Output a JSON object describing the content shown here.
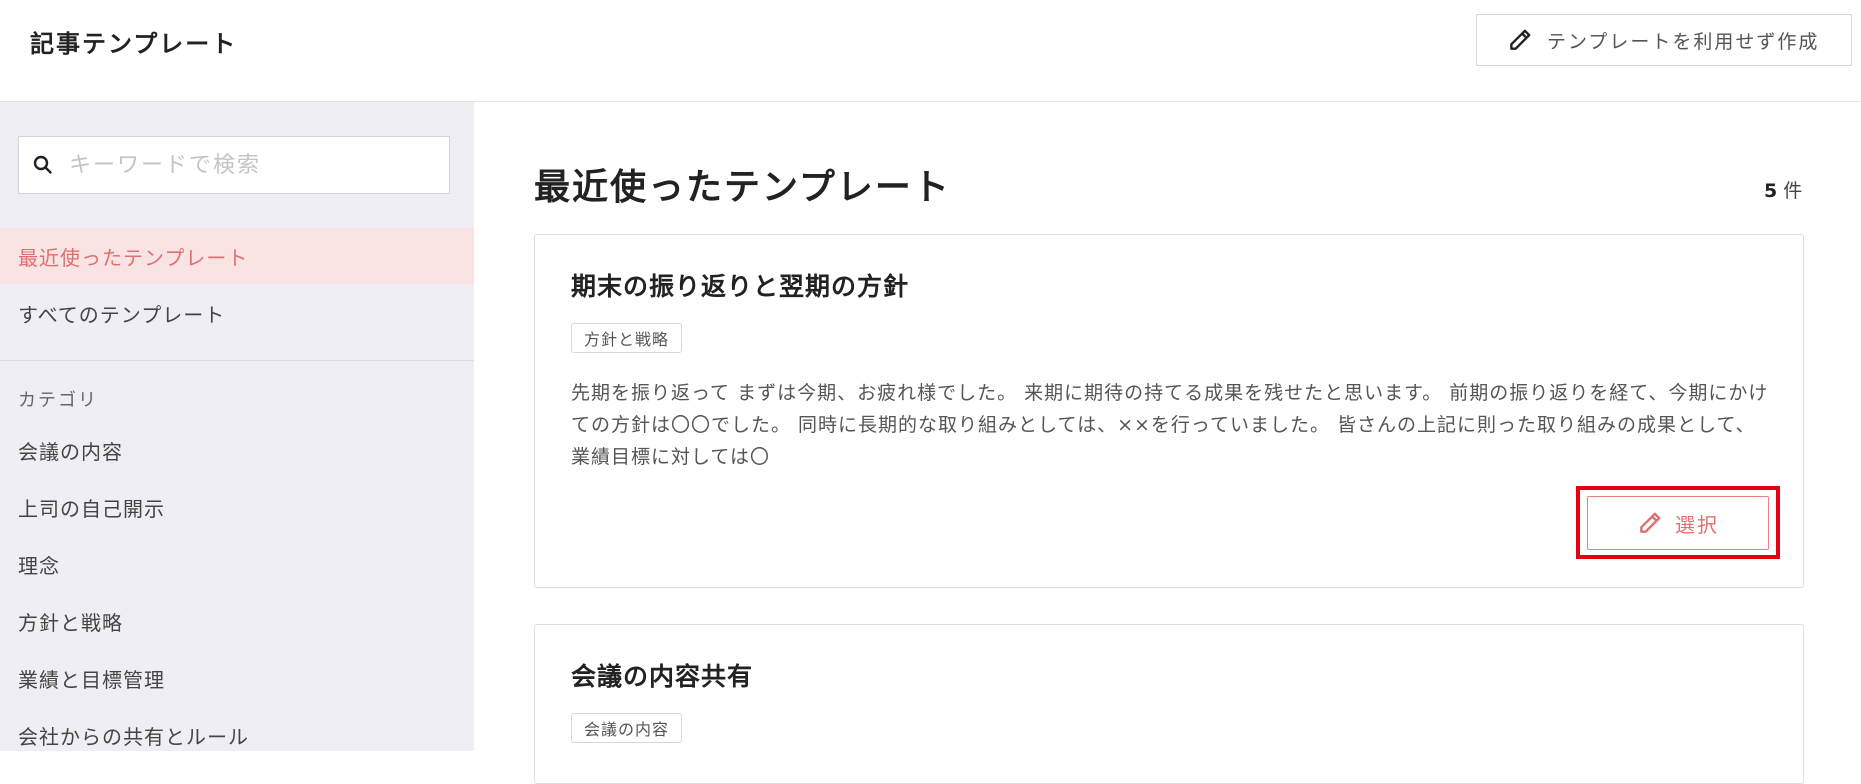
{
  "header": {
    "title": "記事テンプレート",
    "create_without_template_label": "テンプレートを利用せず作成",
    "create_icon": "pencil-icon"
  },
  "sidebar": {
    "search": {
      "placeholder": "キーワードで検索",
      "value": "",
      "icon": "search-icon"
    },
    "nav": [
      {
        "label": "最近使ったテンプレート",
        "active": true
      },
      {
        "label": "すべてのテンプレート",
        "active": false
      }
    ],
    "category_heading": "カテゴリ",
    "categories": [
      {
        "label": "会議の内容"
      },
      {
        "label": "上司の自己開示"
      },
      {
        "label": "理念"
      },
      {
        "label": "方針と戦略"
      },
      {
        "label": "業績と目標管理"
      },
      {
        "label": "会社からの共有とルール"
      }
    ]
  },
  "main": {
    "title": "最近使ったテンプレート",
    "count_number": "5",
    "count_unit": "件",
    "cards": [
      {
        "title": "期末の振り返りと翌期の方針",
        "tag": "方針と戦略",
        "description": "先期を振り返って まずは今期、お疲れ様でした。 来期に期待の持てる成果を残せたと思います。 前期の振り返りを経て、今期にかけての方針は〇〇でした。 同時に長期的な取り組みとしては、××を行っていました。 皆さんの上記に則った取り組みの成果として、業績目標に対しては〇",
        "select_label": "選択",
        "select_icon": "pencil-icon"
      },
      {
        "title": "会議の内容共有",
        "tag": "会議の内容"
      }
    ]
  },
  "colors": {
    "accent": "#e07070",
    "active_bg": "#f9e3e3",
    "sidebar_bg": "#eeeef4",
    "highlight_outline": "#e60012"
  }
}
